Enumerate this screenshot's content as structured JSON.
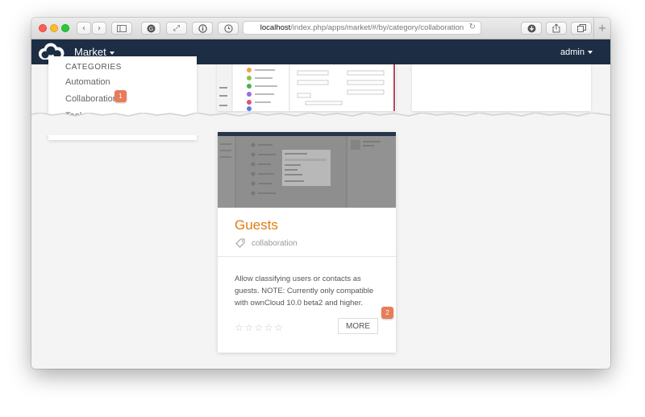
{
  "browser": {
    "url_host": "localhost",
    "url_path": "/index.php/apps/market/#/by/category/collaboration",
    "buttons": [
      "back-icon",
      "forward-icon",
      "sidebar-icon",
      "grammarly-icon",
      "fullscreen-icon",
      "info-icon",
      "history-icon",
      "download-icon",
      "share-icon",
      "tabs-icon",
      "new-tab-icon"
    ]
  },
  "header": {
    "app_name": "Market",
    "user_name": "admin",
    "bg_color": "#1d2d44"
  },
  "sidebar": {
    "title": "CATEGORIES",
    "items": [
      {
        "label": "Automation"
      },
      {
        "label": "Collaboration",
        "badge": "1"
      },
      {
        "label": "Tools"
      }
    ]
  },
  "card": {
    "app_name": "Guests",
    "category": "collaboration",
    "description": "Allow classifying users or contacts as guests. NOTE: Currently only compatible with ownCloud 10.0 beta2 and higher.",
    "rating": 0,
    "max_rating": 5,
    "more_label": "MORE",
    "badge": "2",
    "accent_color": "#e07b0f"
  }
}
